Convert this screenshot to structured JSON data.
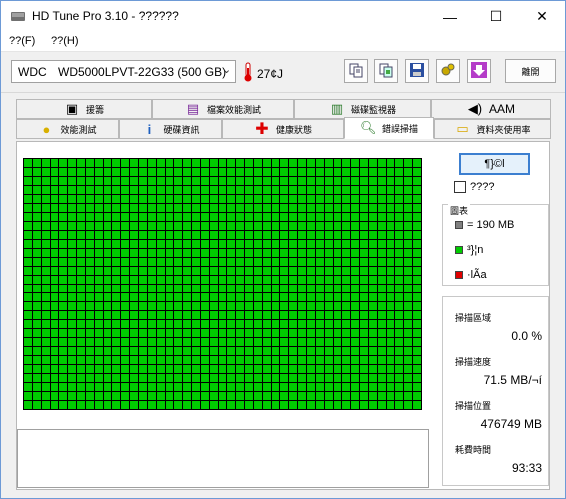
{
  "window": {
    "title": "HD Tune Pro 3.10 - ??????",
    "minimize_glyph": "—",
    "maximize_glyph": "☐",
    "close_glyph": "✕"
  },
  "menu": {
    "items": [
      "??(F)",
      "??(H)"
    ]
  },
  "toolbar": {
    "drive_brand": "WDC",
    "drive_model": "WD5000LPVT-22G33 (500 GB)",
    "temperature": "27¢J",
    "exit_label": "離開",
    "buttons": [
      "copy-text-icon",
      "copy-screenshot-icon",
      "save-icon",
      "options-icon",
      "download-icon"
    ],
    "accent": "#b43cc8"
  },
  "tabs": {
    "row1": [
      {
        "label": "援籌",
        "icon": "toolbox-icon"
      },
      {
        "label": "檔案效能測試",
        "icon": "file-benchmark-icon"
      },
      {
        "label": "磁碟監視器",
        "icon": "monitor-icon"
      },
      {
        "label": "AAM",
        "icon": "speaker-icon"
      }
    ],
    "row2": [
      {
        "label": "效能測試",
        "icon": "lightbulb-icon"
      },
      {
        "label": "硬碟資訊",
        "icon": "info-icon"
      },
      {
        "label": "健康狀態",
        "icon": "health-cross-icon"
      },
      {
        "label": "錯誤掃描",
        "icon": "magnifier-icon",
        "active": true
      },
      {
        "label": "資料夾使用率",
        "icon": "folder-icon"
      }
    ]
  },
  "scan": {
    "start_label": "¶}©l",
    "quick_scan_label": "????",
    "quick_scan_checked": false,
    "block_color": "#00cc00"
  },
  "legend": {
    "title": "圖表",
    "items": [
      {
        "color": "#808080",
        "label": "= 190 MB"
      },
      {
        "color": "#00cc00",
        "label": "³}¦n"
      },
      {
        "color": "#e00000",
        "label": "·lÃa"
      }
    ]
  },
  "stats": [
    {
      "label": "掃描區域",
      "value": "0.0 %"
    },
    {
      "label": "掃描速度",
      "value": "71.5 MB/¬í"
    },
    {
      "label": "掃描位置",
      "value": "476749 MB"
    },
    {
      "label": "耗費時間",
      "value": "93:33"
    }
  ]
}
